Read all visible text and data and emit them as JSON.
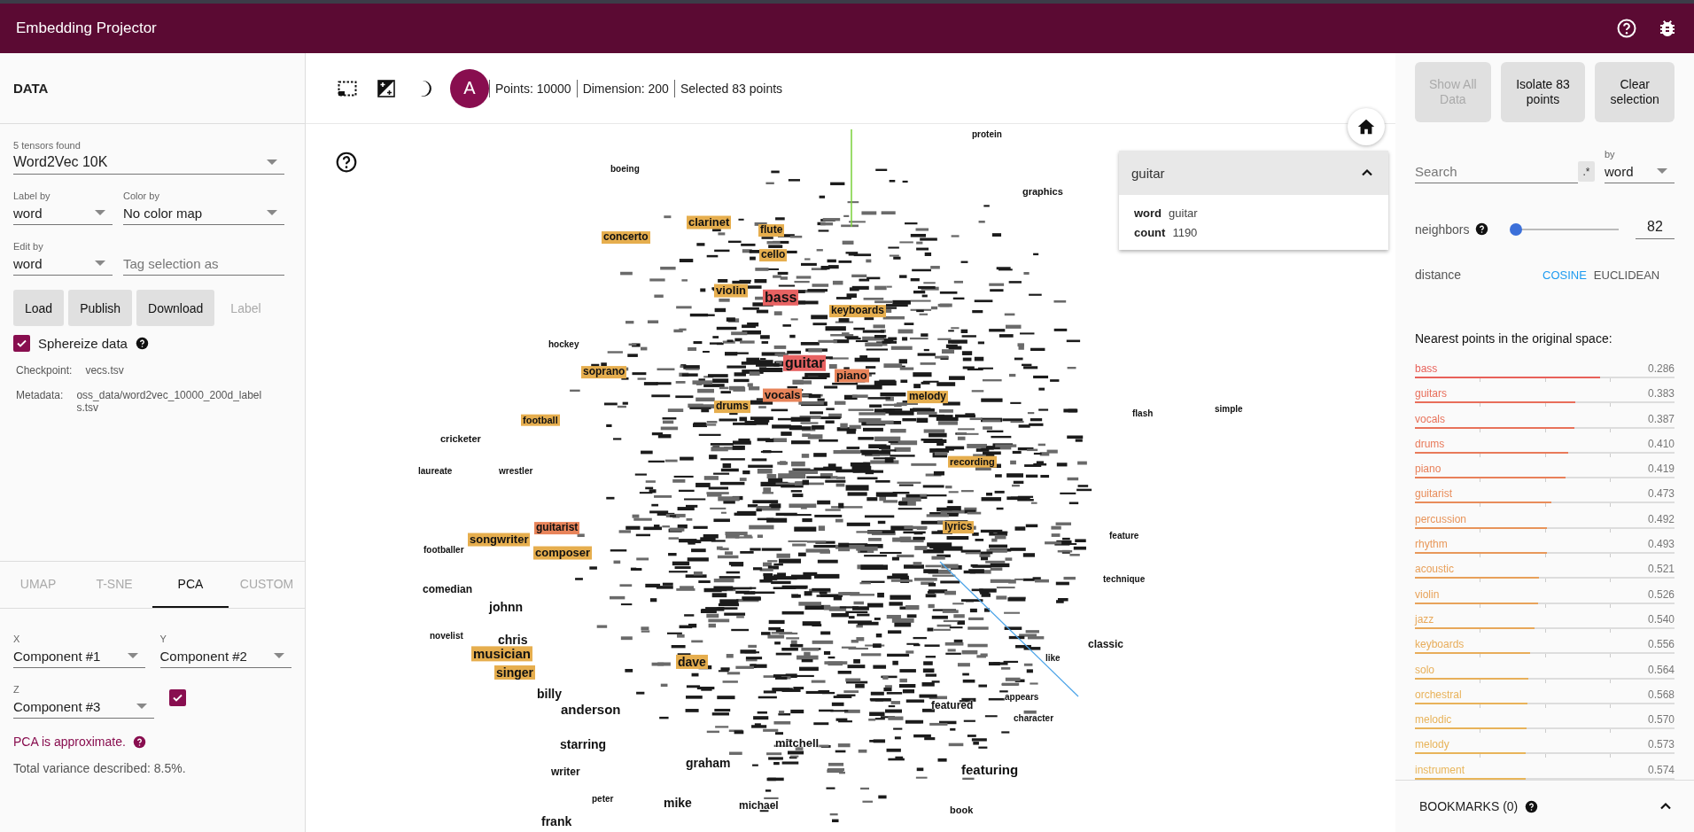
{
  "header": {
    "title": "Embedding Projector"
  },
  "toolbar": {
    "label_mode": {
      "glyph": "A",
      "on": true
    },
    "stats": [
      "Points: 10000",
      "Dimension: 200",
      "Selected 83 points"
    ]
  },
  "data_panel": {
    "title": "DATA",
    "tensors": {
      "label": "5 tensors found",
      "value": "Word2Vec 10K"
    },
    "label_by": {
      "label": "Label by",
      "value": "word"
    },
    "color_by": {
      "label": "Color by",
      "value": "No color map"
    },
    "edit_by": {
      "label": "Edit by",
      "value": "word"
    },
    "tag": {
      "placeholder": "Tag selection as"
    },
    "buttons": [
      {
        "label": "Load",
        "disabled": false
      },
      {
        "label": "Publish",
        "disabled": false
      },
      {
        "label": "Download",
        "disabled": false
      },
      {
        "label": "Label",
        "disabled": true
      }
    ],
    "spherize": {
      "label": "Sphereize data",
      "checked": true
    },
    "checkpoint": {
      "label": "Checkpoint:",
      "value": "vecs.tsv"
    },
    "metadata": {
      "label": "Metadata:",
      "value": "oss_data/word2vec_10000_200d_labels.tsv"
    }
  },
  "projection": {
    "tabs": [
      {
        "label": "UMAP",
        "selected": false
      },
      {
        "label": "T-SNE",
        "selected": false
      },
      {
        "label": "PCA",
        "selected": true
      },
      {
        "label": "CUSTOM",
        "selected": false
      }
    ],
    "x": {
      "label": "X",
      "value": "Component #1"
    },
    "y": {
      "label": "Y",
      "value": "Component #2"
    },
    "z": {
      "label": "Z",
      "value": "Component #3"
    },
    "z_enabled": true,
    "note": "PCA is approximate.",
    "variance": "Total variance described: 8.5%."
  },
  "canvas": {
    "labels": [
      {
        "text": "boeing"
      },
      {
        "text": "protein"
      },
      {
        "text": "graphics"
      },
      {
        "text": "concerto",
        "color": "#e6ae4e"
      },
      {
        "text": "clarinet",
        "color": "#e6ae4e"
      },
      {
        "text": "flute",
        "color": "#e6ae4e"
      },
      {
        "text": "cello",
        "color": "#e6ae4e"
      },
      {
        "text": "violin",
        "color": "#e6ae4e"
      },
      {
        "text": "bass",
        "color": "#e76262"
      },
      {
        "text": "keyboards",
        "color": "#e6ae4e"
      },
      {
        "text": "hockey"
      },
      {
        "text": "soprano",
        "color": "#e6ae4e"
      },
      {
        "text": "guitar",
        "color": "#e76262"
      },
      {
        "text": "piano",
        "color": "#e8845a"
      },
      {
        "text": "vocals",
        "color": "#e8845a"
      },
      {
        "text": "drums",
        "color": "#e6ae4e"
      },
      {
        "text": "melody",
        "color": "#e6ae4e"
      },
      {
        "text": "football",
        "color": "#e6ae4e"
      },
      {
        "text": "flash"
      },
      {
        "text": "simple"
      },
      {
        "text": "cricketer"
      },
      {
        "text": "recording",
        "color": "#e6ae4e"
      },
      {
        "text": "laureate"
      },
      {
        "text": "wrestler"
      },
      {
        "text": "lyrics",
        "color": "#e6ae4e"
      },
      {
        "text": "feature"
      },
      {
        "text": "guitarist",
        "color": "#e8845a"
      },
      {
        "text": "songwriter",
        "color": "#e6ae4e"
      },
      {
        "text": "footballer"
      },
      {
        "text": "composer",
        "color": "#e6ae4e"
      },
      {
        "text": "technique"
      },
      {
        "text": "comedian"
      },
      {
        "text": "johnn"
      },
      {
        "text": "chris"
      },
      {
        "text": "classic"
      },
      {
        "text": "novelist"
      },
      {
        "text": "musician",
        "color": "#e6ae4e"
      },
      {
        "text": "dave",
        "color": "#e6ae4e"
      },
      {
        "text": "like"
      },
      {
        "text": "singer",
        "color": "#e6ae4e"
      },
      {
        "text": "billy"
      },
      {
        "text": "appears"
      },
      {
        "text": "anderson"
      },
      {
        "text": "featured"
      },
      {
        "text": "character"
      },
      {
        "text": "starring"
      },
      {
        "text": "mitchell"
      },
      {
        "text": "graham"
      },
      {
        "text": "featuring"
      },
      {
        "text": "writer"
      },
      {
        "text": "peter"
      },
      {
        "text": "mike"
      },
      {
        "text": "michael"
      },
      {
        "text": "book"
      },
      {
        "text": "frank"
      }
    ],
    "info_card": {
      "title": "guitar",
      "expanded": true,
      "fields": [
        {
          "key": "word",
          "value": "guitar"
        },
        {
          "key": "count",
          "value": "1190"
        }
      ]
    }
  },
  "inspector": {
    "buttons": [
      {
        "label": "Show All Data",
        "disabled": true
      },
      {
        "label": "Isolate 83 points",
        "disabled": false
      },
      {
        "label": "Clear selection",
        "disabled": false
      }
    ],
    "search": {
      "placeholder": "Search",
      "regex": ".*",
      "regex_on": false
    },
    "search_by": {
      "label": "by",
      "value": "word"
    },
    "neighbors": {
      "label": "neighbors",
      "level": 0.05,
      "value": "82"
    },
    "distance": {
      "label": "distance",
      "options": [
        {
          "label": "COSINE",
          "selected": true
        },
        {
          "label": "EUCLIDEAN",
          "selected": false
        }
      ]
    },
    "nearest_title": "Nearest points in the original space:",
    "nearest": [
      {
        "word": "bass",
        "distance": "0.286",
        "level": 0.714,
        "color": "#e8615a"
      },
      {
        "word": "guitars",
        "distance": "0.383",
        "level": 0.617,
        "color": "#e86e5a"
      },
      {
        "word": "vocals",
        "distance": "0.387",
        "level": 0.613,
        "color": "#e8725a"
      },
      {
        "word": "drums",
        "distance": "0.410",
        "level": 0.59,
        "color": "#e87a5a"
      },
      {
        "word": "piano",
        "distance": "0.419",
        "level": 0.581,
        "color": "#e8805a"
      },
      {
        "word": "guitarist",
        "distance": "0.473",
        "level": 0.527,
        "color": "#e88c5a"
      },
      {
        "word": "percussion",
        "distance": "0.492",
        "level": 0.508,
        "color": "#e8945a"
      },
      {
        "word": "rhythm",
        "distance": "0.493",
        "level": 0.507,
        "color": "#e8985a"
      },
      {
        "word": "acoustic",
        "distance": "0.521",
        "level": 0.479,
        "color": "#e8a05a"
      },
      {
        "word": "violin",
        "distance": "0.526",
        "level": 0.474,
        "color": "#e8a35a"
      },
      {
        "word": "jazz",
        "distance": "0.540",
        "level": 0.46,
        "color": "#e8a85a"
      },
      {
        "word": "keyboards",
        "distance": "0.556",
        "level": 0.444,
        "color": "#e8ad5a"
      },
      {
        "word": "solo",
        "distance": "0.564",
        "level": 0.436,
        "color": "#e8b05a"
      },
      {
        "word": "orchestral",
        "distance": "0.568",
        "level": 0.432,
        "color": "#e8b25a"
      },
      {
        "word": "melodic",
        "distance": "0.570",
        "level": 0.43,
        "color": "#e8b35a"
      },
      {
        "word": "melody",
        "distance": "0.573",
        "level": 0.427,
        "color": "#e8b45a"
      },
      {
        "word": "instrument",
        "distance": "0.574",
        "level": 0.426,
        "color": "#e8b55a"
      }
    ]
  },
  "bookmarks": {
    "title": "BOOKMARKS (0)",
    "expanded": false
  }
}
